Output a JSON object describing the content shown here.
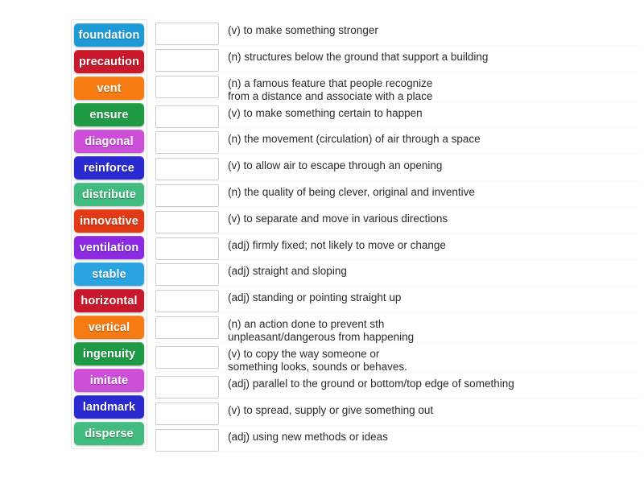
{
  "activity": {
    "type": "match-up-word-tiles",
    "tile_column_label": "word tiles",
    "rows_label": "definition rows"
  },
  "tiles": [
    {
      "label": "foundation",
      "color": "#1e9ad6"
    },
    {
      "label": "precaution",
      "color": "#c9182b"
    },
    {
      "label": "vent",
      "color": "#f57b12"
    },
    {
      "label": "ensure",
      "color": "#1f9b46"
    },
    {
      "label": "diagonal",
      "color": "#cc4ed9"
    },
    {
      "label": "reinforce",
      "color": "#2a2ad1"
    },
    {
      "label": "distribute",
      "color": "#41bb7f"
    },
    {
      "label": "innovative",
      "color": "#e13a14"
    },
    {
      "label": "ventilation",
      "color": "#8b2ae0"
    },
    {
      "label": "stable",
      "color": "#29a4e0"
    },
    {
      "label": "horizontal",
      "color": "#c9182b"
    },
    {
      "label": "vertical",
      "color": "#f57b12"
    },
    {
      "label": "ingenuity",
      "color": "#1f9b46"
    },
    {
      "label": "imitate",
      "color": "#cc4ed9"
    },
    {
      "label": "landmark",
      "color": "#2a2ad1"
    },
    {
      "label": "disperse",
      "color": "#41bb7f"
    }
  ],
  "rows": [
    {
      "answer": "",
      "definition": "(v) to make something stronger"
    },
    {
      "answer": "",
      "definition": "(n) structures below the ground that support a building"
    },
    {
      "answer": "",
      "definition": "(n) a famous feature that people recognize\nfrom a distance and associate with a place"
    },
    {
      "answer": "",
      "definition": "(v) to make something certain to happen"
    },
    {
      "answer": "",
      "definition": "(n) the movement (circulation) of air through a space"
    },
    {
      "answer": "",
      "definition": "(v) to allow air to escape through an opening"
    },
    {
      "answer": "",
      "definition": "(n) the quality of being clever, original and inventive"
    },
    {
      "answer": "",
      "definition": "(v) to separate and move in various directions"
    },
    {
      "answer": "",
      "definition": "(adj) firmly fixed; not likely to move or change"
    },
    {
      "answer": "",
      "definition": "(adj) straight and sloping"
    },
    {
      "answer": "",
      "definition": "(adj) standing or pointing straight up"
    },
    {
      "answer": "",
      "definition": "(n) an action done to prevent sth\nunpleasant/dangerous from happening"
    },
    {
      "answer": "",
      "definition": "(v) to copy the way someone or\nsomething looks, sounds or behaves."
    },
    {
      "answer": "",
      "definition": "(adj) parallel to the ground or bottom/top edge of something"
    },
    {
      "answer": "",
      "definition": "(v) to spread, supply or give something out"
    },
    {
      "answer": "",
      "definition": "(adj) using new methods or ideas"
    }
  ]
}
